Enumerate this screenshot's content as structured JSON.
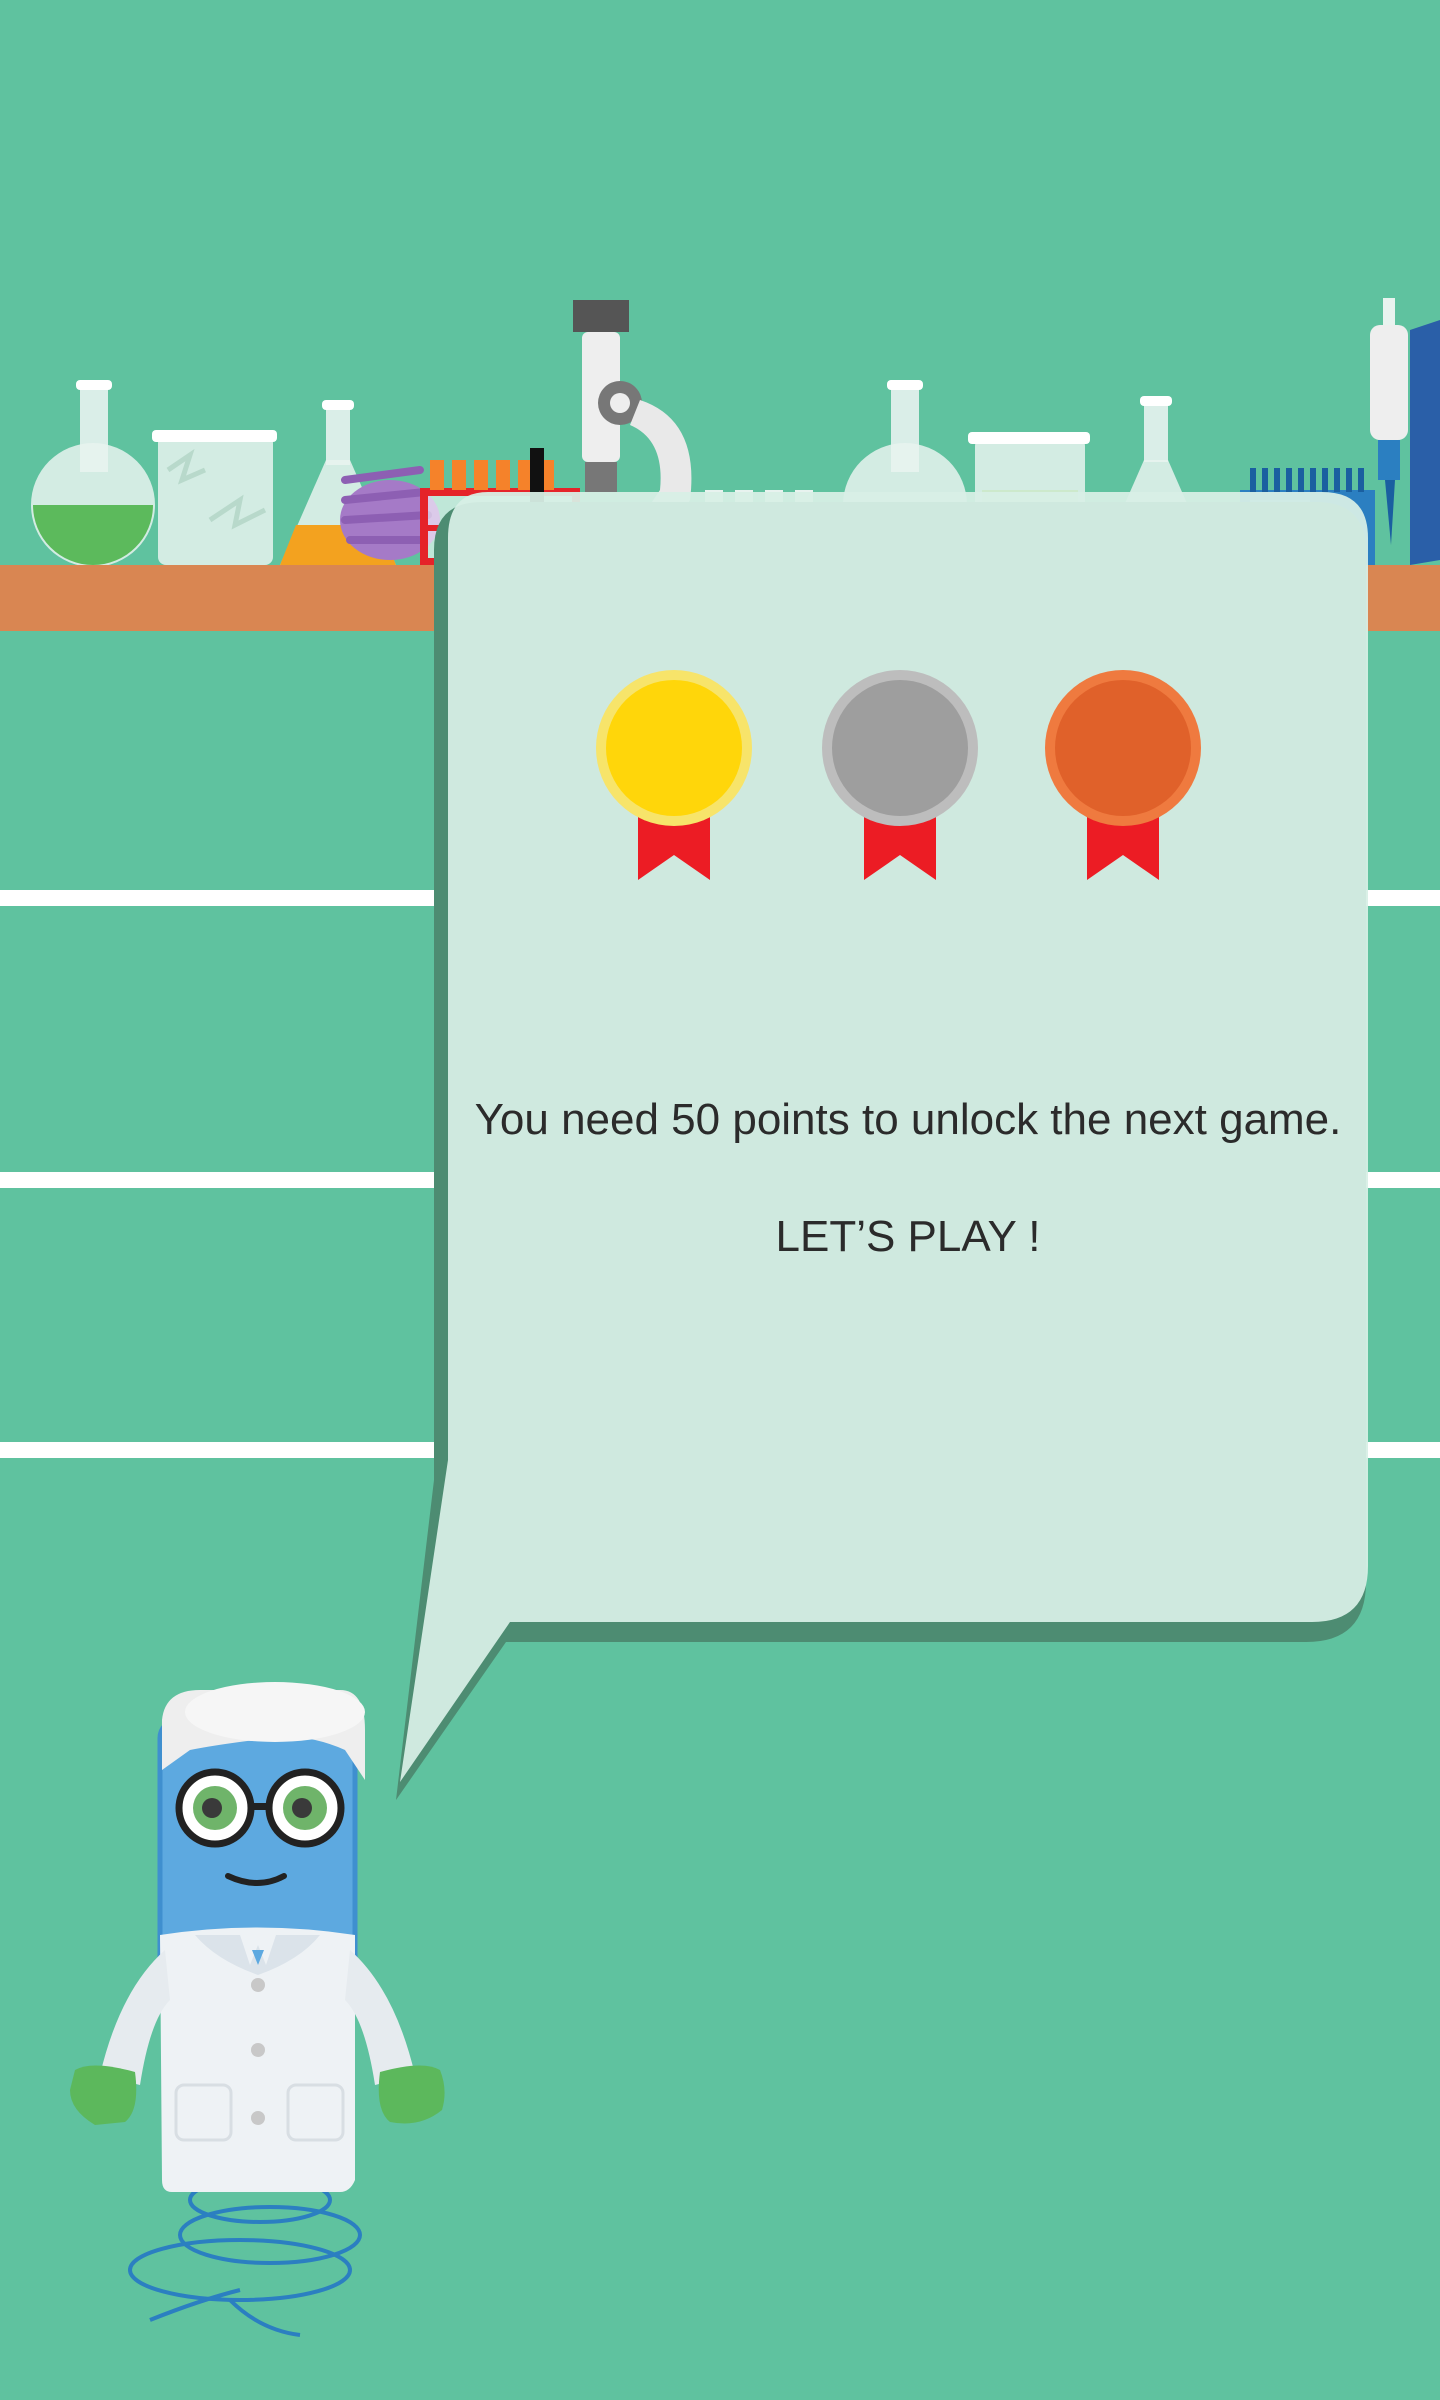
{
  "dialog": {
    "unlock_message": "You need 50 points to unlock the next game.",
    "play_label": "LET’S PLAY !"
  },
  "medals": [
    {
      "name": "gold-medal",
      "color": "#ffd60a"
    },
    {
      "name": "silver-medal",
      "color": "#9e9e9e"
    },
    {
      "name": "bronze-medal",
      "color": "#e0612a"
    }
  ],
  "colors": {
    "background": "#5fc29f",
    "shelf": "#d98652",
    "bubble": "#d8efe6",
    "ribbon": "#ec1c24"
  }
}
